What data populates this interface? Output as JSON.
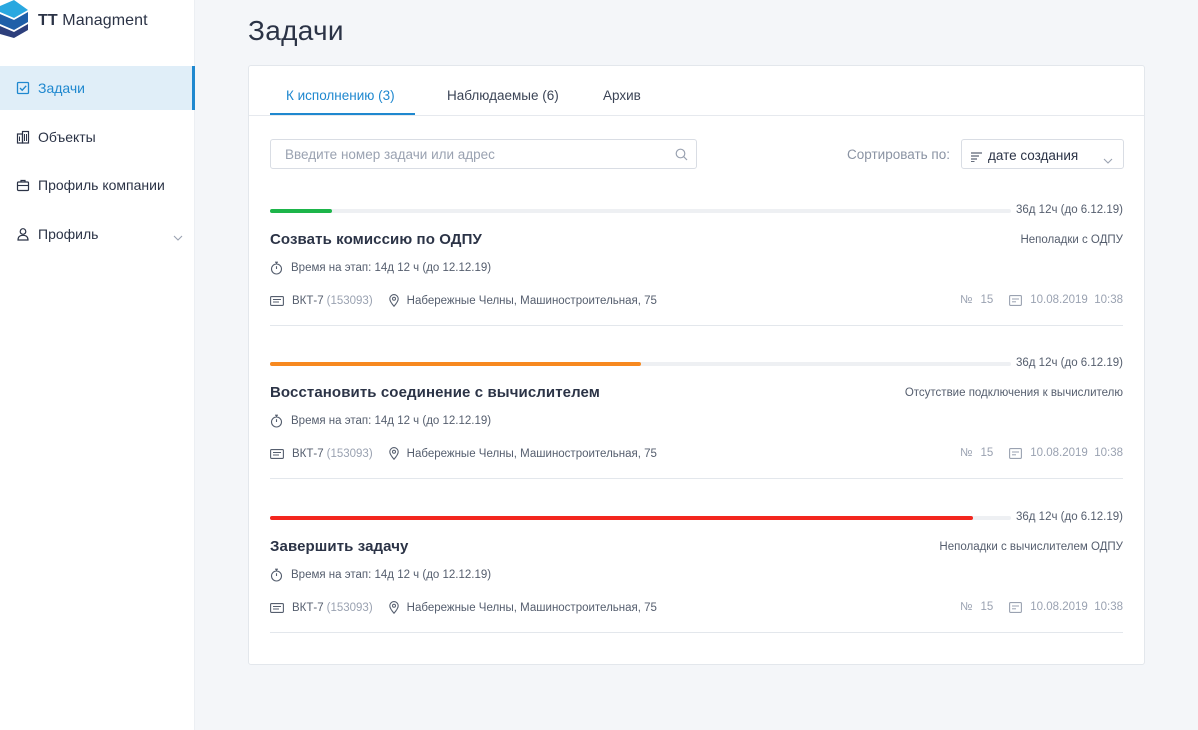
{
  "app": {
    "logo_bold": "TT",
    "logo_rest": " Managment"
  },
  "sidebar": {
    "items": [
      {
        "label": "Задачи",
        "icon": "checkbox-icon",
        "active": true
      },
      {
        "label": "Объекты",
        "icon": "buildings-icon",
        "active": false
      },
      {
        "label": "Профиль компании",
        "icon": "briefcase-icon",
        "active": false
      },
      {
        "label": "Профиль",
        "icon": "user-icon",
        "active": false,
        "expandable": true
      }
    ]
  },
  "page": {
    "title": "Задачи"
  },
  "tabs": [
    {
      "label": "К исполнению (3)",
      "active": true
    },
    {
      "label": "Наблюдаемые (6)",
      "active": false
    },
    {
      "label": "Архив",
      "active": false
    }
  ],
  "search": {
    "placeholder": "Введите номер задачи или адрес",
    "value": ""
  },
  "sort": {
    "label": "Сортировать по:",
    "value": "дате создания"
  },
  "colors": {
    "accent": "#1f88cf",
    "progress_green": "#1db54a",
    "progress_orange": "#f7891f",
    "progress_red": "#f3261e"
  },
  "tasks": [
    {
      "progress": 0.084,
      "progress_color": "#1db54a",
      "deadline": "36д 12ч (до 6.12.19)",
      "title": "Созвать комиссию по ОДПУ",
      "category": "Неполадки с ОДПУ",
      "stage_time": "Время на этап: 14д 12 ч (до 12.12.19)",
      "device": "ВКТ-7",
      "device_id": "(153093)",
      "address": "Набережные Челны, Машиностроительная, 75",
      "number_label": "№",
      "number": "15",
      "created": "10.08.2019  10:38"
    },
    {
      "progress": 0.5,
      "progress_color": "#f7891f",
      "deadline": "36д 12ч (до 6.12.19)",
      "title": "Восстановить соединение с вычислителем",
      "category": "Отсутствие подключения к вычислителю",
      "stage_time": "Время на этап: 14д 12 ч (до 12.12.19)",
      "device": "ВКТ-7",
      "device_id": "(153093)",
      "address": "Набережные Челны, Машиностроительная, 75",
      "number_label": "№",
      "number": "15",
      "created": "10.08.2019  10:38"
    },
    {
      "progress": 0.949,
      "progress_color": "#f3261e",
      "deadline": "36д 12ч (до 6.12.19)",
      "title": "Завершить задачу",
      "category": "Неполадки с вычислителем ОДПУ",
      "stage_time": "Время на этап: 14д 12 ч (до 12.12.19)",
      "device": "ВКТ-7",
      "device_id": "(153093)",
      "address": "Набережные Челны, Машиностроительная, 75",
      "number_label": "№",
      "number": "15",
      "created": "10.08.2019  10:38"
    }
  ]
}
